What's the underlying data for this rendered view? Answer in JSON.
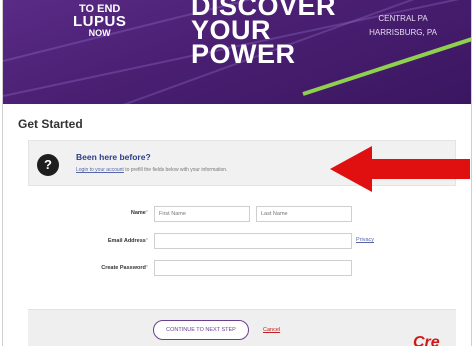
{
  "banner": {
    "logo": {
      "line1": "TO END",
      "line2": "LUPUS",
      "line3": "NOW"
    },
    "headline": {
      "line1": "DISCOVER",
      "line2": "YOUR",
      "line3": "POWER"
    },
    "location": {
      "region": "CENTRAL PA",
      "city": "HARRISBURG, PA"
    },
    "colors": {
      "purple": "#4a1f72",
      "green": "#8fd14f"
    }
  },
  "page_title": "Get Started",
  "been_here": {
    "icon": "question-mark",
    "icon_text": "?",
    "title": "Been here before?",
    "login_link": "Login to your account",
    "rest": " to prefill the fields below with your information."
  },
  "form": {
    "name_label": "Name",
    "first_name_placeholder": "First Name",
    "last_name_placeholder": "Last Name",
    "email_label": "Email Address",
    "privacy_link": "Privacy",
    "password_label": "Create Password",
    "required_marker": "*"
  },
  "footer": {
    "next_button": "CONTINUE TO NEXT STEP",
    "cancel_link": "Cancel"
  },
  "annotation": {
    "arrow_color": "#e01010",
    "credit_text": "Cre"
  }
}
